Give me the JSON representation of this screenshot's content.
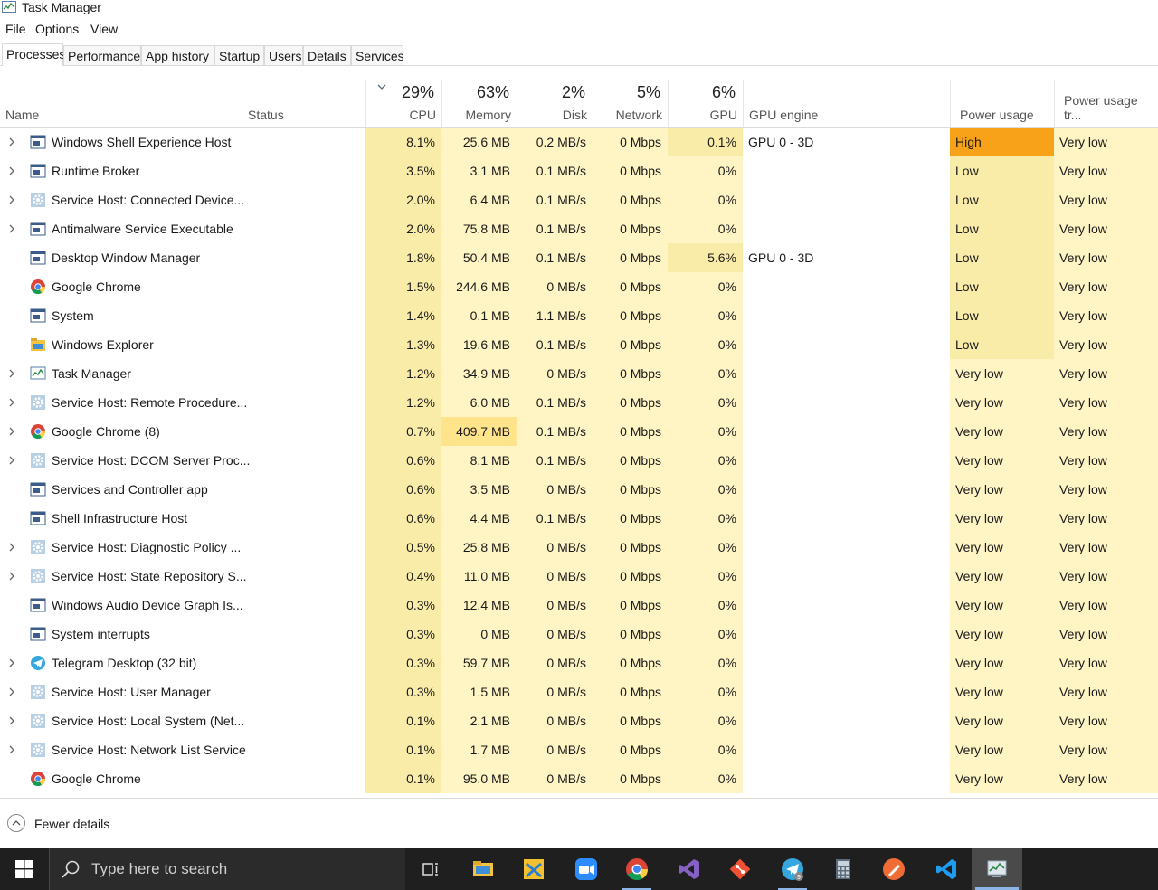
{
  "window": {
    "title": "Task Manager"
  },
  "menu": [
    "File",
    "Options",
    "View"
  ],
  "tabs": [
    "Processes",
    "Performance",
    "App history",
    "Startup",
    "Users",
    "Details",
    "Services"
  ],
  "header": {
    "name": "Name",
    "status": "Status",
    "cpu": {
      "pct": "29%",
      "label": "CPU"
    },
    "memory": {
      "pct": "63%",
      "label": "Memory"
    },
    "disk": {
      "pct": "2%",
      "label": "Disk"
    },
    "network": {
      "pct": "5%",
      "label": "Network"
    },
    "gpu": {
      "pct": "6%",
      "label": "GPU"
    },
    "gpu_engine": "GPU engine",
    "power_usage": "Power usage",
    "power_trend": "Power usage tr..."
  },
  "processes": [
    {
      "name": "Windows Shell Experience Host",
      "icon": "window-app-icon",
      "expand": true,
      "cpu": "8.1%",
      "memory": "25.6 MB",
      "disk": "0.2 MB/s",
      "network": "0 Mbps",
      "gpu": "0.1%",
      "gpu_engine": "GPU 0 - 3D",
      "power": "High",
      "trend": "Very low"
    },
    {
      "name": "Runtime Broker",
      "icon": "window-app-icon",
      "expand": true,
      "cpu": "3.5%",
      "memory": "3.1 MB",
      "disk": "0.1 MB/s",
      "network": "0 Mbps",
      "gpu": "0%",
      "gpu_engine": "",
      "power": "Low",
      "trend": "Very low"
    },
    {
      "name": "Service Host: Connected Device...",
      "icon": "gear-icon",
      "expand": true,
      "cpu": "2.0%",
      "memory": "6.4 MB",
      "disk": "0.1 MB/s",
      "network": "0 Mbps",
      "gpu": "0%",
      "gpu_engine": "",
      "power": "Low",
      "trend": "Very low"
    },
    {
      "name": "Antimalware Service Executable",
      "icon": "window-app-icon",
      "expand": true,
      "cpu": "2.0%",
      "memory": "75.8 MB",
      "disk": "0.1 MB/s",
      "network": "0 Mbps",
      "gpu": "0%",
      "gpu_engine": "",
      "power": "Low",
      "trend": "Very low"
    },
    {
      "name": "Desktop Window Manager",
      "icon": "window-app-icon",
      "expand": false,
      "cpu": "1.8%",
      "memory": "50.4 MB",
      "disk": "0.1 MB/s",
      "network": "0 Mbps",
      "gpu": "5.6%",
      "gpu_engine": "GPU 0 - 3D",
      "power": "Low",
      "trend": "Very low"
    },
    {
      "name": "Google Chrome",
      "icon": "chrome-icon",
      "expand": false,
      "cpu": "1.5%",
      "memory": "244.6 MB",
      "disk": "0 MB/s",
      "network": "0 Mbps",
      "gpu": "0%",
      "gpu_engine": "",
      "power": "Low",
      "trend": "Very low"
    },
    {
      "name": "System",
      "icon": "window-app-icon",
      "expand": false,
      "cpu": "1.4%",
      "memory": "0.1 MB",
      "disk": "1.1 MB/s",
      "network": "0 Mbps",
      "gpu": "0%",
      "gpu_engine": "",
      "power": "Low",
      "trend": "Very low"
    },
    {
      "name": "Windows Explorer",
      "icon": "folder-icon",
      "expand": false,
      "cpu": "1.3%",
      "memory": "19.6 MB",
      "disk": "0.1 MB/s",
      "network": "0 Mbps",
      "gpu": "0%",
      "gpu_engine": "",
      "power": "Low",
      "trend": "Very low"
    },
    {
      "name": "Task Manager",
      "icon": "task-manager-icon",
      "expand": true,
      "cpu": "1.2%",
      "memory": "34.9 MB",
      "disk": "0 MB/s",
      "network": "0 Mbps",
      "gpu": "0%",
      "gpu_engine": "",
      "power": "Very low",
      "trend": "Very low"
    },
    {
      "name": "Service Host: Remote Procedure...",
      "icon": "gear-icon",
      "expand": true,
      "cpu": "1.2%",
      "memory": "6.0 MB",
      "disk": "0.1 MB/s",
      "network": "0 Mbps",
      "gpu": "0%",
      "gpu_engine": "",
      "power": "Very low",
      "trend": "Very low"
    },
    {
      "name": "Google Chrome (8)",
      "icon": "chrome-icon",
      "expand": true,
      "cpu": "0.7%",
      "memory": "409.7 MB",
      "disk": "0.1 MB/s",
      "network": "0 Mbps",
      "gpu": "0%",
      "gpu_engine": "",
      "power": "Very low",
      "trend": "Very low"
    },
    {
      "name": "Service Host: DCOM Server Proc...",
      "icon": "gear-icon",
      "expand": true,
      "cpu": "0.6%",
      "memory": "8.1 MB",
      "disk": "0.1 MB/s",
      "network": "0 Mbps",
      "gpu": "0%",
      "gpu_engine": "",
      "power": "Very low",
      "trend": "Very low"
    },
    {
      "name": "Services and Controller app",
      "icon": "window-app-icon",
      "expand": false,
      "cpu": "0.6%",
      "memory": "3.5 MB",
      "disk": "0 MB/s",
      "network": "0 Mbps",
      "gpu": "0%",
      "gpu_engine": "",
      "power": "Very low",
      "trend": "Very low"
    },
    {
      "name": "Shell Infrastructure Host",
      "icon": "window-app-icon",
      "expand": false,
      "cpu": "0.6%",
      "memory": "4.4 MB",
      "disk": "0.1 MB/s",
      "network": "0 Mbps",
      "gpu": "0%",
      "gpu_engine": "",
      "power": "Very low",
      "trend": "Very low"
    },
    {
      "name": "Service Host: Diagnostic Policy ...",
      "icon": "gear-icon",
      "expand": true,
      "cpu": "0.5%",
      "memory": "25.8 MB",
      "disk": "0 MB/s",
      "network": "0 Mbps",
      "gpu": "0%",
      "gpu_engine": "",
      "power": "Very low",
      "trend": "Very low"
    },
    {
      "name": "Service Host: State Repository S...",
      "icon": "gear-icon",
      "expand": true,
      "cpu": "0.4%",
      "memory": "11.0 MB",
      "disk": "0 MB/s",
      "network": "0 Mbps",
      "gpu": "0%",
      "gpu_engine": "",
      "power": "Very low",
      "trend": "Very low"
    },
    {
      "name": "Windows Audio Device Graph Is...",
      "icon": "window-app-icon",
      "expand": false,
      "cpu": "0.3%",
      "memory": "12.4 MB",
      "disk": "0 MB/s",
      "network": "0 Mbps",
      "gpu": "0%",
      "gpu_engine": "",
      "power": "Very low",
      "trend": "Very low"
    },
    {
      "name": "System interrupts",
      "icon": "window-app-icon",
      "expand": false,
      "cpu": "0.3%",
      "memory": "0 MB",
      "disk": "0 MB/s",
      "network": "0 Mbps",
      "gpu": "0%",
      "gpu_engine": "",
      "power": "Very low",
      "trend": "Very low"
    },
    {
      "name": "Telegram Desktop (32 bit)",
      "icon": "telegram-icon",
      "expand": true,
      "cpu": "0.3%",
      "memory": "59.7 MB",
      "disk": "0 MB/s",
      "network": "0 Mbps",
      "gpu": "0%",
      "gpu_engine": "",
      "power": "Very low",
      "trend": "Very low"
    },
    {
      "name": "Service Host: User Manager",
      "icon": "gear-icon",
      "expand": true,
      "cpu": "0.3%",
      "memory": "1.5 MB",
      "disk": "0 MB/s",
      "network": "0 Mbps",
      "gpu": "0%",
      "gpu_engine": "",
      "power": "Very low",
      "trend": "Very low"
    },
    {
      "name": "Service Host: Local System (Net...",
      "icon": "gear-icon",
      "expand": true,
      "cpu": "0.1%",
      "memory": "2.1 MB",
      "disk": "0 MB/s",
      "network": "0 Mbps",
      "gpu": "0%",
      "gpu_engine": "",
      "power": "Very low",
      "trend": "Very low"
    },
    {
      "name": "Service Host: Network List Service",
      "icon": "gear-icon",
      "expand": true,
      "cpu": "0.1%",
      "memory": "1.7 MB",
      "disk": "0 MB/s",
      "network": "0 Mbps",
      "gpu": "0%",
      "gpu_engine": "",
      "power": "Very low",
      "trend": "Very low"
    },
    {
      "name": "Google Chrome",
      "icon": "chrome-icon",
      "expand": false,
      "cpu": "0.1%",
      "memory": "95.0 MB",
      "disk": "0 MB/s",
      "network": "0 Mbps",
      "gpu": "0%",
      "gpu_engine": "",
      "power": "Very low",
      "trend": "Very low"
    }
  ],
  "footer": {
    "fewer_details": "Fewer details"
  },
  "taskbar": {
    "search_placeholder": "Type here to search",
    "apps": [
      "task-view-icon",
      "file-explorer-icon",
      "xampp-icon",
      "zoom-icon",
      "chrome-icon",
      "visual-studio-icon",
      "git-icon",
      "telegram-icon",
      "calculator-icon",
      "postman-icon",
      "vscode-icon",
      "task-manager-icon"
    ],
    "telegram_badge": "9"
  },
  "colors": {
    "heat_light": "#fff4c4",
    "heat_mid": "#f9eca8",
    "heat_strong": "#ffe48c",
    "power_high": "#f8a21a",
    "taskbar_bg": "#1f1f1f"
  }
}
